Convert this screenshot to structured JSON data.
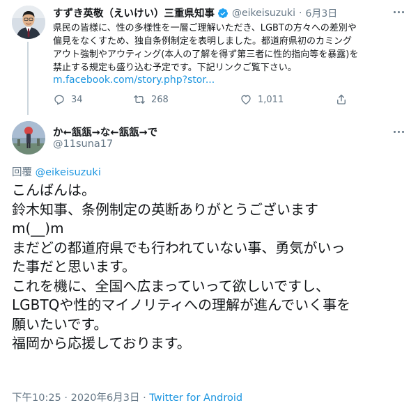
{
  "parent_tweet": {
    "name": "すずき英敬（えいけい）三重県知事",
    "handle": "@eikeisuzuki",
    "dot": "·",
    "date": "6月3日",
    "text_lines": [
      "県民の皆様に、性の多様性を一層ご理解いただき、LGBTの方々への差別や",
      "偏見をなくすため、独自条例制定を表明しました。都道府県初のカミング",
      "アウト強制やアウティング(本人の了解を得ず第三者に性的指向等を暴露)を",
      "禁止する規定も盛り込む予定です。下記リンクご覧下さい。"
    ],
    "link": "m.facebook.com/story.php?stor...",
    "stats": {
      "replies": "34",
      "retweets": "268",
      "likes": "1,011"
    }
  },
  "reply_tweet": {
    "name": "か←㼨㼨→な←㼨㼨→で",
    "handle": "@11suna17",
    "replying_prefix": "回覆",
    "replying_to": "@eikeisuzuki",
    "text_lines": [
      "こんばんは。",
      "鈴木知事、条例制定の英断ありがとうございます",
      "m(__)m",
      "まだどの都道府県でも行われていない事、勇気がいっ",
      "た事だと思います。",
      "これを機に、全国へ広まっていって欲しいですし、",
      "LGBTQや性的マイノリティへの理解が進んでいく事を",
      "願いたいです。",
      "福岡から応援しております。"
    ],
    "timestamp": "下午10:25 · 2020年6月3日 ·",
    "source": "Twitter for Android"
  },
  "colors": {
    "text": "#14171a",
    "secondary": "#657786",
    "link": "#1b95e0",
    "verified": "#1da1f2"
  }
}
